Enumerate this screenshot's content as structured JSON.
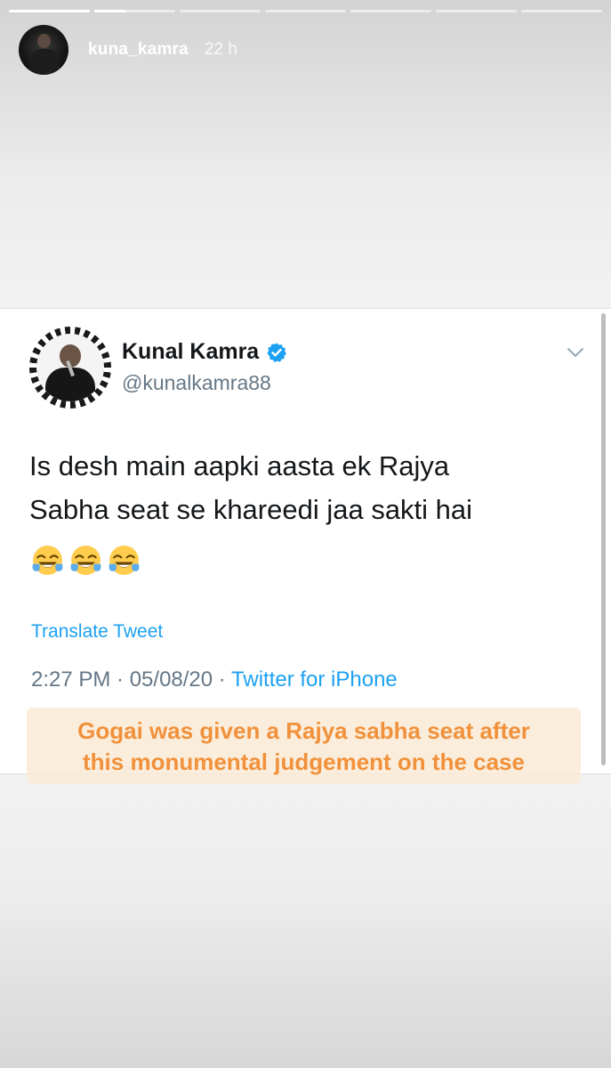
{
  "story": {
    "progress": {
      "segments": [
        1,
        0.4,
        0,
        0,
        0,
        0,
        0
      ]
    },
    "user": {
      "username": "kuna_kamra",
      "time": "22 h",
      "avatar_icon": "profile-avatar"
    }
  },
  "tweet": {
    "name": "Kunal Kamra",
    "handle": "@kunalkamra88",
    "verified_icon": "verified-badge-icon",
    "text_line1": "Is desh main aapki aasta ek Rajya",
    "text_line2": "Sabha seat se khareedi jaa sakti hai",
    "emojis": [
      "😂",
      "😂",
      "😂"
    ],
    "translate_label": "Translate Tweet",
    "timestamp": "2:27 PM · 05/08/20 · ",
    "source": "Twitter for iPhone"
  },
  "annotation": {
    "line1": "Gogai was given a Rajya sabha seat after",
    "line2": "this monumental judgement on the case"
  },
  "colors": {
    "twitter_blue": "#1da1f2",
    "annotation_text": "#f1913b",
    "annotation_bg": "#faebd7",
    "tweet_gray": "#657786"
  }
}
